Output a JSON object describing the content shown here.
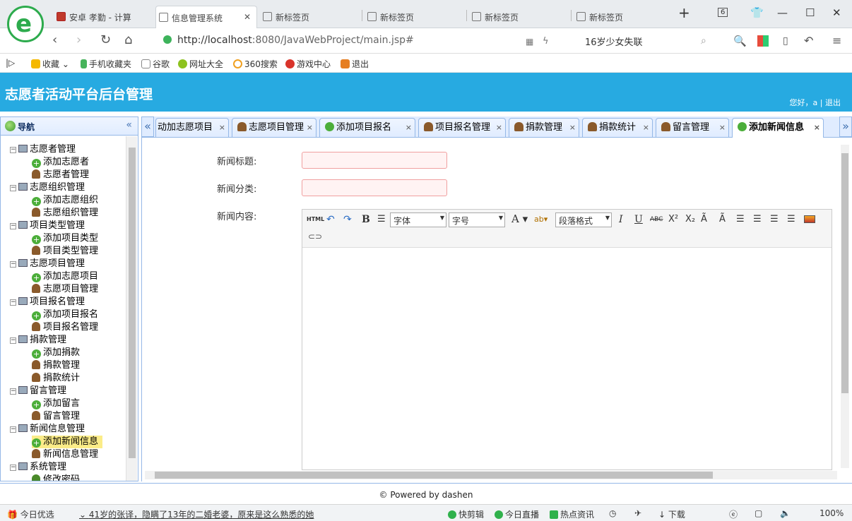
{
  "browser": {
    "tabs": [
      {
        "label": "安卓 孝勤 - 计算"
      },
      {
        "label": "信息管理系统"
      },
      {
        "label": "新标签页"
      },
      {
        "label": "新标签页"
      },
      {
        "label": "新标签页"
      },
      {
        "label": "新标签页"
      }
    ],
    "tab_count": "6",
    "url_host": "http://localhost",
    "url_rest": ":8080/JavaWebProject/main.jsp#",
    "news_text": "16岁少女失联"
  },
  "bookmarks": [
    {
      "label": "收藏"
    },
    {
      "label": "手机收藏夹"
    },
    {
      "label": "谷歌"
    },
    {
      "label": "网址大全"
    },
    {
      "label": "360搜索"
    },
    {
      "label": "游戏中心"
    },
    {
      "label": "退出"
    }
  ],
  "app": {
    "title": "志愿者活动平台后台管理",
    "greeting": "您好，a",
    "separator": "|",
    "logout": "退出"
  },
  "nav": {
    "title": "导航",
    "tree": [
      {
        "label": "志愿者管理",
        "level": 0
      },
      {
        "label": "添加志愿者",
        "level": 1,
        "icon": "add"
      },
      {
        "label": "志愿者管理",
        "level": 1,
        "icon": "user"
      },
      {
        "label": "志愿组织管理",
        "level": 0
      },
      {
        "label": "添加志愿组织",
        "level": 1,
        "icon": "add"
      },
      {
        "label": "志愿组织管理",
        "level": 1,
        "icon": "user"
      },
      {
        "label": "项目类型管理",
        "level": 0
      },
      {
        "label": "添加项目类型",
        "level": 1,
        "icon": "add"
      },
      {
        "label": "项目类型管理",
        "level": 1,
        "icon": "user"
      },
      {
        "label": "志愿项目管理",
        "level": 0
      },
      {
        "label": "添加志愿项目",
        "level": 1,
        "icon": "add"
      },
      {
        "label": "志愿项目管理",
        "level": 1,
        "icon": "user"
      },
      {
        "label": "项目报名管理",
        "level": 0
      },
      {
        "label": "添加项目报名",
        "level": 1,
        "icon": "add"
      },
      {
        "label": "项目报名管理",
        "level": 1,
        "icon": "user"
      },
      {
        "label": "捐款管理",
        "level": 0
      },
      {
        "label": "添加捐款",
        "level": 1,
        "icon": "add"
      },
      {
        "label": "捐款管理",
        "level": 1,
        "icon": "user"
      },
      {
        "label": "捐款统计",
        "level": 1,
        "icon": "user"
      },
      {
        "label": "留言管理",
        "level": 0
      },
      {
        "label": "添加留言",
        "level": 1,
        "icon": "add"
      },
      {
        "label": "留言管理",
        "level": 1,
        "icon": "user"
      },
      {
        "label": "新闻信息管理",
        "level": 0
      },
      {
        "label": "添加新闻信息",
        "level": 1,
        "icon": "add",
        "selected": true
      },
      {
        "label": "新闻信息管理",
        "level": 1,
        "icon": "user"
      },
      {
        "label": "系统管理",
        "level": 0
      },
      {
        "label": "修改密码",
        "level": 1,
        "icon": "edit"
      }
    ]
  },
  "content_tabs": [
    {
      "label": "动加志愿项目",
      "icon": "none"
    },
    {
      "label": "志愿项目管理",
      "icon": "user"
    },
    {
      "label": "添加项目报名",
      "icon": "add"
    },
    {
      "label": "项目报名管理",
      "icon": "user"
    },
    {
      "label": "捐款管理",
      "icon": "user"
    },
    {
      "label": "捐款统计",
      "icon": "user"
    },
    {
      "label": "留言管理",
      "icon": "user"
    },
    {
      "label": "添加新闻信息",
      "icon": "add",
      "active": true
    }
  ],
  "form": {
    "title_label": "新闻标题:",
    "title_value": "",
    "category_label": "新闻分类:",
    "category_value": "",
    "content_label": "新闻内容:",
    "toolbar": {
      "html": "HTML",
      "font_family": "字体",
      "font_size": "字号",
      "paragraph": "段落格式"
    }
  },
  "footer": {
    "text": "© Powered by dashen"
  },
  "statusbar": {
    "left1": "今日优选",
    "headline": "41岁的张译，隐瞒了13年的二婚老婆，原来是这么熟悉的她",
    "quickclip": "快剪辑",
    "live": "今日直播",
    "hotnews": "热点资讯",
    "download": "下载",
    "zoom": "100%"
  }
}
